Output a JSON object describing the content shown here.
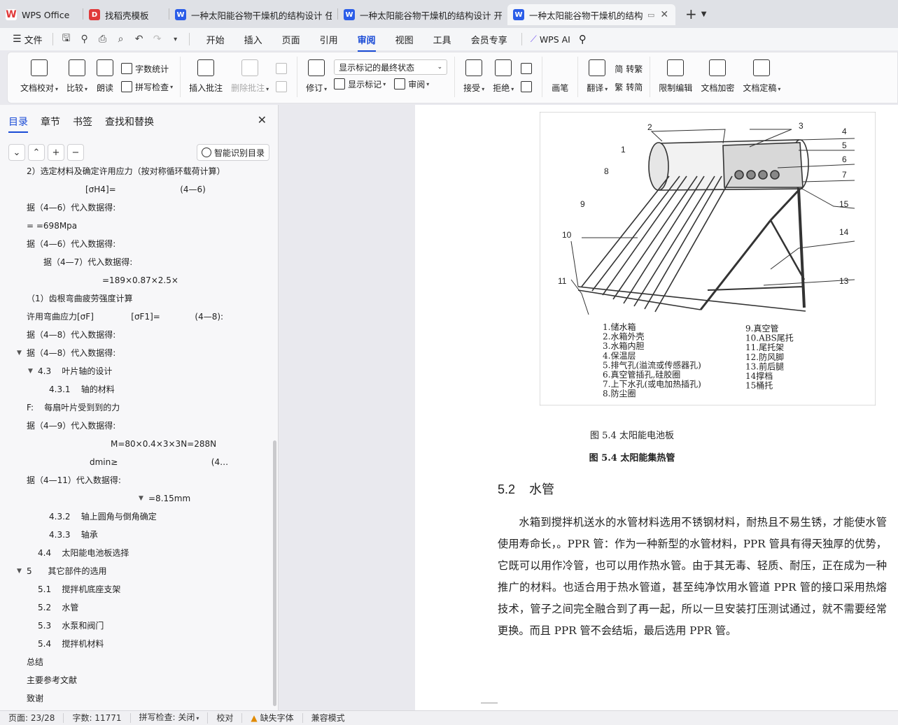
{
  "tabs": [
    {
      "label": "WPS Office",
      "icon": "wps-logo-icon",
      "active": false
    },
    {
      "label": "找稻壳模板",
      "icon": "docer-icon",
      "active": false
    },
    {
      "label": "一种太阳能谷物干燥机的结构设计 任",
      "icon": "writer-doc-icon",
      "active": false
    },
    {
      "label": "一种太阳能谷物干燥机的结构设计 开",
      "icon": "writer-doc-icon",
      "active": false
    },
    {
      "label": "一种太阳能谷物干燥机的结构",
      "icon": "writer-doc-icon",
      "active": true
    }
  ],
  "menubar": {
    "file": "文件",
    "items": [
      "开始",
      "插入",
      "页面",
      "引用",
      "审阅",
      "视图",
      "工具",
      "会员专享"
    ],
    "active": "审阅",
    "wps_ai": "WPS AI"
  },
  "ribbon": {
    "proofread": "文档校对",
    "compare": "比较",
    "read_aloud": "朗读",
    "word_count": "字数统计",
    "spell_check": "拼写检查",
    "insert_comment": "插入批注",
    "delete_comment": "删除批注",
    "revise": "修订",
    "markup_state": "显示标记的最终状态",
    "show_markup": "显示标记",
    "review": "审阅",
    "accept": "接受",
    "reject": "拒绝",
    "pen": "画笔",
    "translate": "翻译",
    "to_traditional": "转繁",
    "to_simplified": "转简",
    "restrict_edit": "限制编辑",
    "encrypt": "文档加密",
    "finalize": "文档定稿"
  },
  "panel": {
    "tabs": [
      "目录",
      "章节",
      "书签",
      "查找和替换"
    ],
    "active_tab": "目录",
    "smart_button": "智能识别目录",
    "outline": [
      {
        "text": "2）选定材料及确定许用应力（按对称循环载荷计算）",
        "indent": 38,
        "arrow": false
      },
      {
        "text": "[σH4]=                        (4—6)",
        "indent": 122,
        "arrow": false
      },
      {
        "text": "据（4—6）代入数据得:",
        "indent": 38,
        "arrow": false
      },
      {
        "text": "= =698Mpa",
        "indent": 38,
        "arrow": false
      },
      {
        "text": "据（4—6）代入数据得:",
        "indent": 38,
        "arrow": false
      },
      {
        "text": "据（4—7）代入数据得:",
        "indent": 62,
        "arrow": false
      },
      {
        "text": "=189×0.87×2.5×",
        "indent": 146,
        "arrow": false
      },
      {
        "text": "（1）齿根弯曲疲劳强度计算",
        "indent": 38,
        "arrow": false
      },
      {
        "text": "许用弯曲应力[σF]              [σF1]=             (4—8):",
        "indent": 38,
        "arrow": false
      },
      {
        "text": "据（4—8）代入数据得:",
        "indent": 38,
        "arrow": false
      },
      {
        "text": "据（4—8）代入数据得:",
        "indent": 38,
        "arrow": true
      },
      {
        "text": "4.3    叶片轴的设计",
        "indent": 54,
        "arrow": true
      },
      {
        "text": "4.3.1    轴的材料",
        "indent": 70,
        "arrow": false
      },
      {
        "text": "F:    每扇叶片受到到的力",
        "indent": 38,
        "arrow": false
      },
      {
        "text": "据（4—9）代入数据得:",
        "indent": 38,
        "arrow": false
      },
      {
        "text": "M=80×0.4×3×3N=288N",
        "indent": 158,
        "arrow": false
      },
      {
        "text": "dmin≥                                   (4…",
        "indent": 128,
        "arrow": false
      },
      {
        "text": "据（4—11）代入数据得:",
        "indent": 38,
        "arrow": false
      },
      {
        "text": "=8.15mm",
        "indent": 212,
        "arrow": true
      },
      {
        "text": "4.3.2    轴上圆角与倒角确定",
        "indent": 70,
        "arrow": false
      },
      {
        "text": "4.3.3    轴承",
        "indent": 70,
        "arrow": false
      },
      {
        "text": "4.4    太阳能电池板选择",
        "indent": 54,
        "arrow": false
      },
      {
        "text": "5      其它部件的选用",
        "indent": 38,
        "arrow": true
      },
      {
        "text": "5.1    搅拌机底座支架",
        "indent": 54,
        "arrow": false
      },
      {
        "text": "5.2    水管",
        "indent": 54,
        "arrow": false
      },
      {
        "text": "5.3    水泵和阀门",
        "indent": 54,
        "arrow": false
      },
      {
        "text": "5.4    搅拌机材料",
        "indent": 54,
        "arrow": false
      },
      {
        "text": "总结",
        "indent": 38,
        "arrow": false
      },
      {
        "text": "主要参考文献",
        "indent": 38,
        "arrow": false
      },
      {
        "text": "致谢",
        "indent": 38,
        "arrow": false
      }
    ]
  },
  "document": {
    "figure_labels": {
      "numbers": [
        "1",
        "2",
        "3",
        "4",
        "5",
        "6",
        "7",
        "8",
        "9",
        "10",
        "11",
        "13",
        "14",
        "15"
      ],
      "legend_left": [
        "1.储水箱",
        "2.水箱外壳",
        "3.水箱内胆",
        "4.保温层",
        "5.排气孔(溢流或传感器孔)",
        "6.真空管插孔,硅胶圈",
        "7.上下水孔(或电加热插孔)",
        "8.防尘圈"
      ],
      "legend_right": [
        "9.真空管",
        "10.ABS尾托",
        "11.尾托架",
        "12.防风脚",
        "13.前后腿",
        "14撑档",
        "15桶托"
      ]
    },
    "caption1": "图 5.4  太阳能电池板",
    "caption2": "图 5.4  太阳能集热管",
    "heading_num": "5.2",
    "heading_text": "水管",
    "paragraph": "水箱到搅拌机送水的水管材料选用不锈钢材料，耐热且不易生锈，才能使水管使用寿命长，。PPR 管：作为一种新型的水管材料，PPR 管具有得天独厚的优势，它既可以用作冷管，也可以用作热水管。由于其无毒、轻质、耐压，正在成为一种推广的材料。也适合用于热水管道，甚至纯净饮用水管道 PPR 管的接口采用热熔技术，管子之间完全融合到了再一起，所以一旦安装打压测试通过，就不需要经常更换。而且 PPR 管不会结垢，最后选用 PPR 管。"
  },
  "statusbar": {
    "page": "页面: 23/28",
    "words": "字数: 11771",
    "spell": "拼写检查: 关闭",
    "proof": "校对",
    "missing_font": "缺失字体",
    "compat": "兼容模式"
  },
  "colors": {
    "accent": "#1a4bd6",
    "wps_red": "#e03a3a",
    "writer_blue": "#2b5de8"
  }
}
